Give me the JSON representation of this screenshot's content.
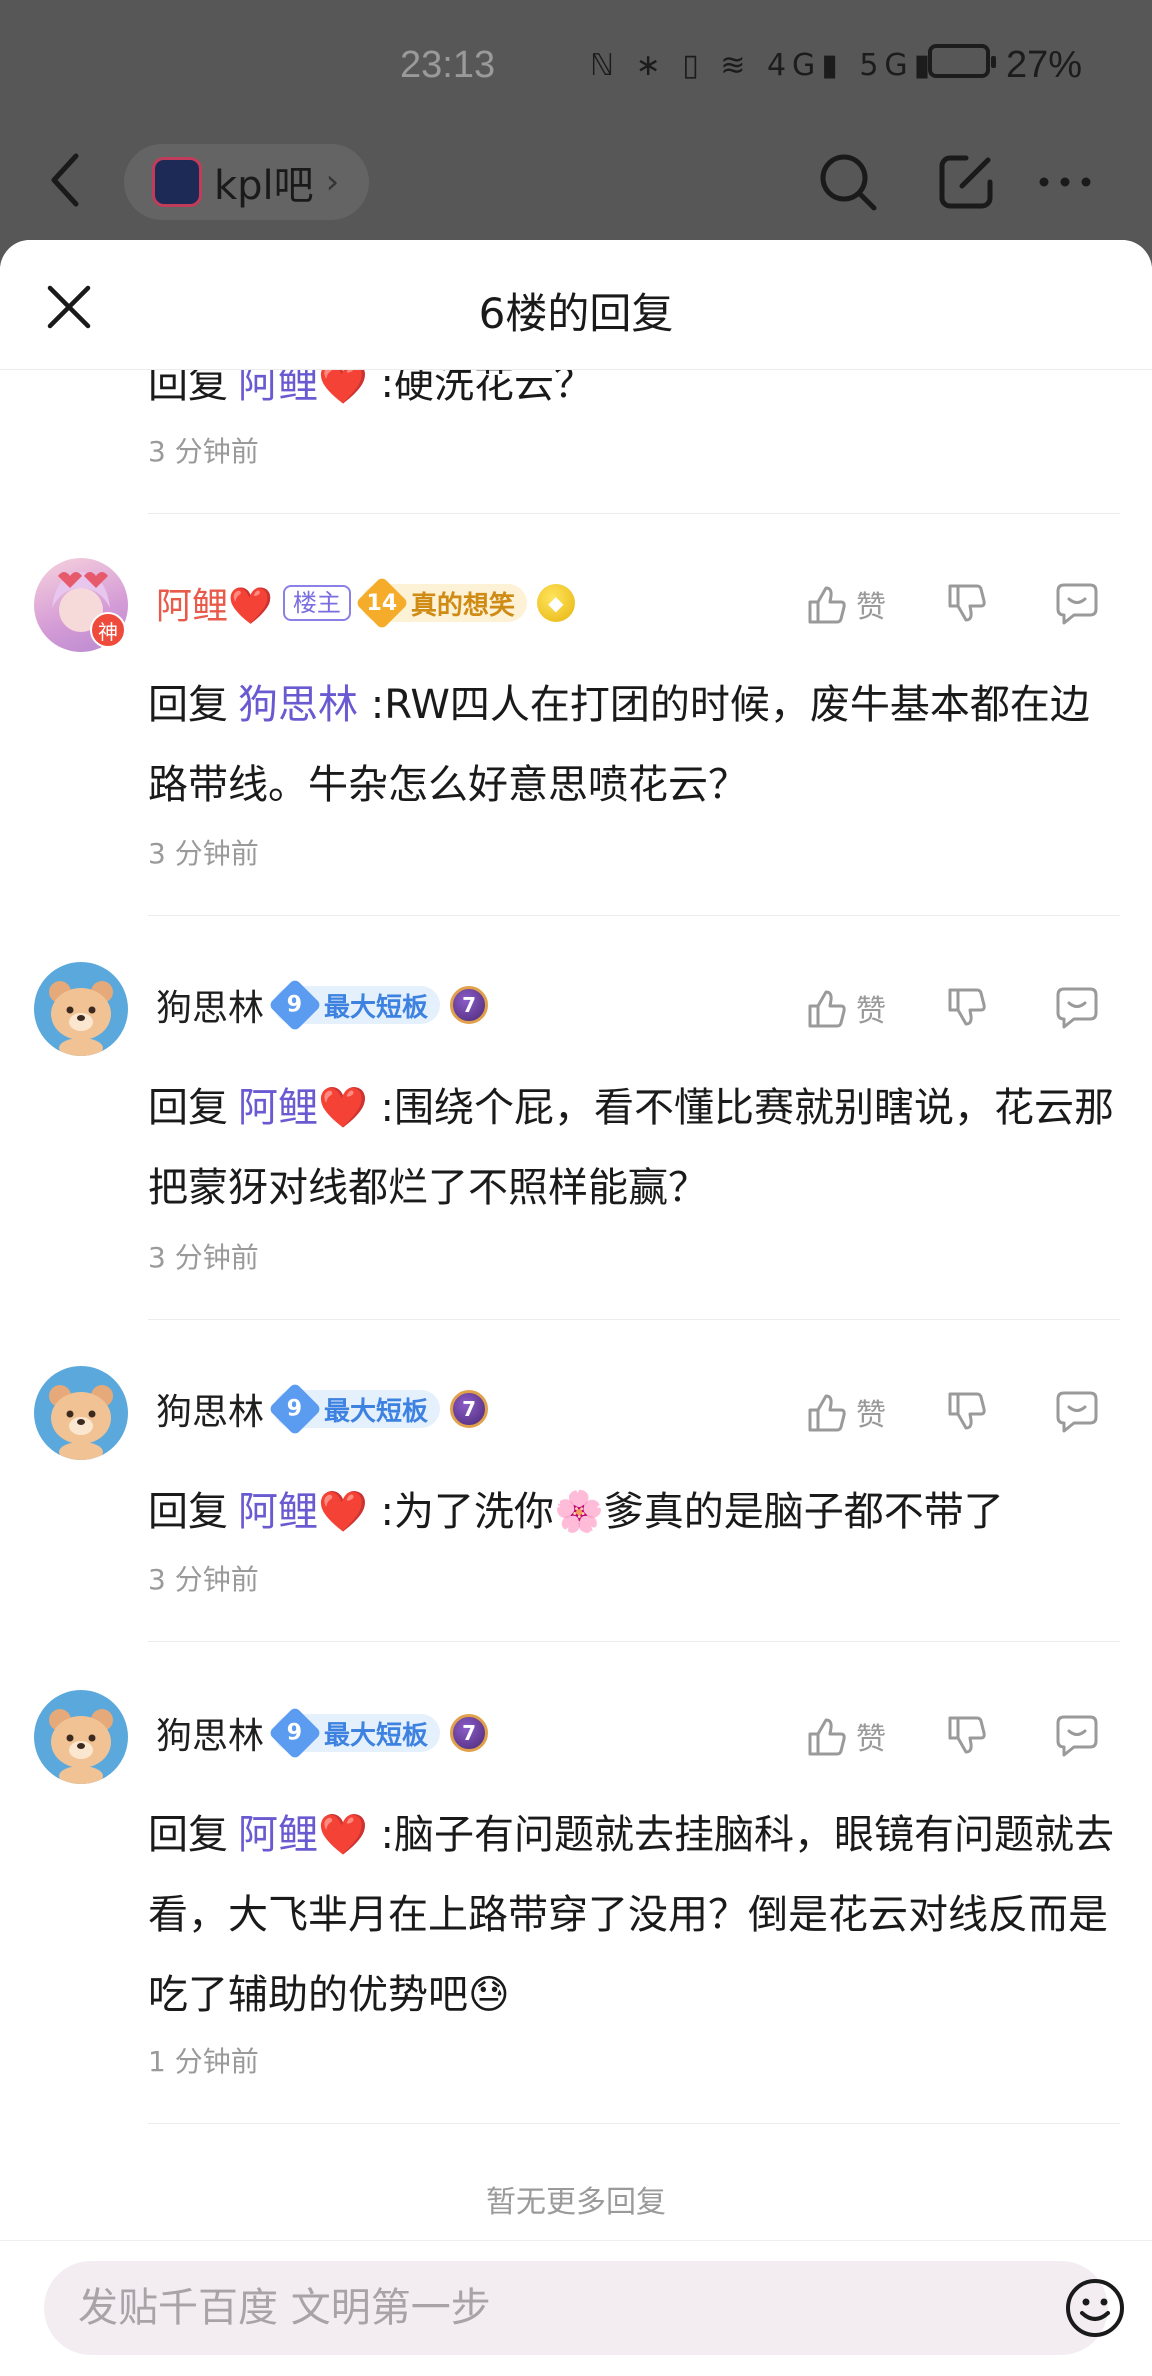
{
  "status_bar": {
    "time": "23:13",
    "network_icons": "ℕ ∗ ▯ ≋ 4G▮ 5G▮",
    "battery_pct": "27%"
  },
  "top_nav": {
    "forum_name": "kpl吧",
    "forum_chevron": "›"
  },
  "sheet": {
    "title": "6楼的回复"
  },
  "partial_reply": {
    "reply_prefix": "回复",
    "target": "阿鲤",
    "target_heart": "❤️",
    "text": " :硬洗花云？",
    "time": "3 分钟前"
  },
  "replies": [
    {
      "author": "阿鲤",
      "author_heart": "❤️",
      "author_red": true,
      "is_op": true,
      "op_label": "楼主",
      "level": "14",
      "level_title": "真的想笑",
      "level_color": "gold",
      "avatar_badge": "神",
      "reply_prefix": "回复",
      "target": "狗思林",
      "target_heart": "",
      "text": " :RW四人在打团的时候，废牛基本都在边路带线。牛杂怎么好意思喷花云？",
      "time": "3 分钟前",
      "like_label": "赞"
    },
    {
      "author": "狗思林",
      "author_heart": "",
      "author_red": false,
      "is_op": false,
      "level": "9",
      "level_title": "最大短板",
      "level_color": "blue",
      "medal": "7",
      "reply_prefix": "回复",
      "target": "阿鲤",
      "target_heart": "❤️",
      "text": " :围绕个屁，看不懂比赛就别瞎说，花云那把蒙犽对线都烂了不照样能赢？",
      "time": "3 分钟前",
      "like_label": "赞"
    },
    {
      "author": "狗思林",
      "author_heart": "",
      "author_red": false,
      "is_op": false,
      "level": "9",
      "level_title": "最大短板",
      "level_color": "blue",
      "medal": "7",
      "reply_prefix": "回复",
      "target": "阿鲤",
      "target_heart": "❤️",
      "text": " :为了洗你🌸爹真的是脑子都不带了",
      "time": "3 分钟前",
      "like_label": "赞"
    },
    {
      "author": "狗思林",
      "author_heart": "",
      "author_red": false,
      "is_op": false,
      "level": "9",
      "level_title": "最大短板",
      "level_color": "blue",
      "medal": "7",
      "reply_prefix": "回复",
      "target": "阿鲤",
      "target_heart": "❤️",
      "text": " :脑子有问题就去挂脑科，眼镜有问题就去看，大飞芈月在上路带穿了没用？倒是花云对线反而是吃了辅助的优势吧😓",
      "time": "1 分钟前",
      "like_label": "赞"
    }
  ],
  "footer": {
    "no_more": "暂无更多回复",
    "input_placeholder": "发贴千百度 文明第一步"
  },
  "colors": {
    "link": "#6a5ad1",
    "op_name": "#e85a4a",
    "meta_gray": "#9a9a9a"
  }
}
